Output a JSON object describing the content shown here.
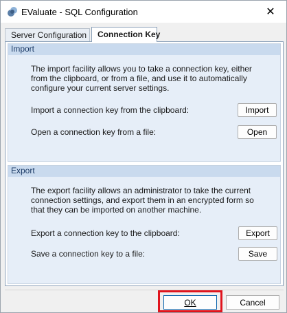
{
  "window": {
    "title": "EValuate - SQL Configuration",
    "close_glyph": "✕"
  },
  "tabs": [
    {
      "label": "Server Configuration",
      "active": false
    },
    {
      "label": "Connection Key",
      "active": true
    }
  ],
  "import_group": {
    "header": "Import",
    "description_lines": [
      "The import facility allows you to take a connection key, either",
      "from the clipboard,  or from a file,  and use it to  automatically",
      "configure your current server settings."
    ],
    "rows": [
      {
        "label": "Import a connection key from the clipboard:",
        "button": "Import"
      },
      {
        "label": "Open a connection key from a file:",
        "button": "Open"
      }
    ]
  },
  "export_group": {
    "header": "Export",
    "description_lines": [
      "The export facility allows an administrator to take the current",
      "connection settings, and export them in an encrypted form so",
      "that they can be imported on another machine."
    ],
    "rows": [
      {
        "label": "Export a connection key to the clipboard:",
        "button": "Export"
      },
      {
        "label": "Save a connection key to a file:",
        "button": "Save"
      }
    ]
  },
  "dialog_buttons": {
    "ok_label": "OK",
    "cancel_label": "Cancel"
  },
  "colors": {
    "highlight": "#e0141d",
    "group_header_bg": "#c9daee",
    "group_body_bg": "#e6eef8"
  },
  "icons": {
    "app": "app-logo-icon",
    "close": "close-icon"
  }
}
